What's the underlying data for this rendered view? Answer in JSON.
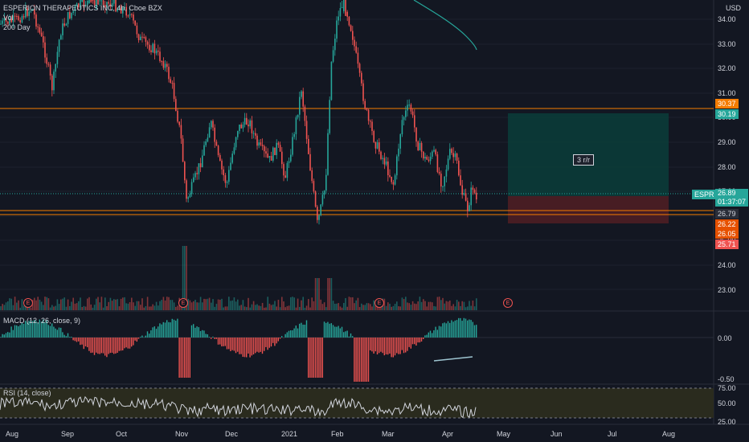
{
  "legend": {
    "symbol_line": "ESPERION THERAPEUTICS INC, 4h, Cboe BZX",
    "vol_label": "Vol",
    "ma_label": "200 Day"
  },
  "price_axis": {
    "currency": "USD",
    "ticks": [
      "34.00",
      "33.00",
      "32.00",
      "31.00",
      "30.00",
      "29.00",
      "28.00",
      "27.00",
      "26.00",
      "25.00",
      "24.00",
      "23.00"
    ]
  },
  "price_tags": {
    "resistance": "30.37",
    "target": "30.19",
    "symbol": "ESPR",
    "last": "26.89",
    "countdown": "01:37:07",
    "support": "26.79",
    "entry": "26.22",
    "low": "26.05",
    "stop": "25.71"
  },
  "position_tool": {
    "label": "3 r/r"
  },
  "earnings_marker": "E",
  "macd": {
    "label": "MACD (12, 26, close, 9)",
    "ticks": [
      "0.00",
      "-0.50"
    ]
  },
  "rsi": {
    "label": "RSI (14, close)",
    "ticks": [
      "75.00",
      "50.00",
      "25.00"
    ]
  },
  "time_axis": [
    "Aug",
    "Sep",
    "Oct",
    "Nov",
    "Dec",
    "2021",
    "Feb",
    "Mar",
    "Apr",
    "May",
    "Jun",
    "Jul",
    "Aug"
  ],
  "colors": {
    "up": "#26a69a",
    "down": "#ef5350",
    "background": "#131722",
    "resistance_line": "#f57c00",
    "target_zone": "#0b3b38",
    "stop_zone": "#4a1e24",
    "rsi_band": "#2a2b1e"
  }
}
